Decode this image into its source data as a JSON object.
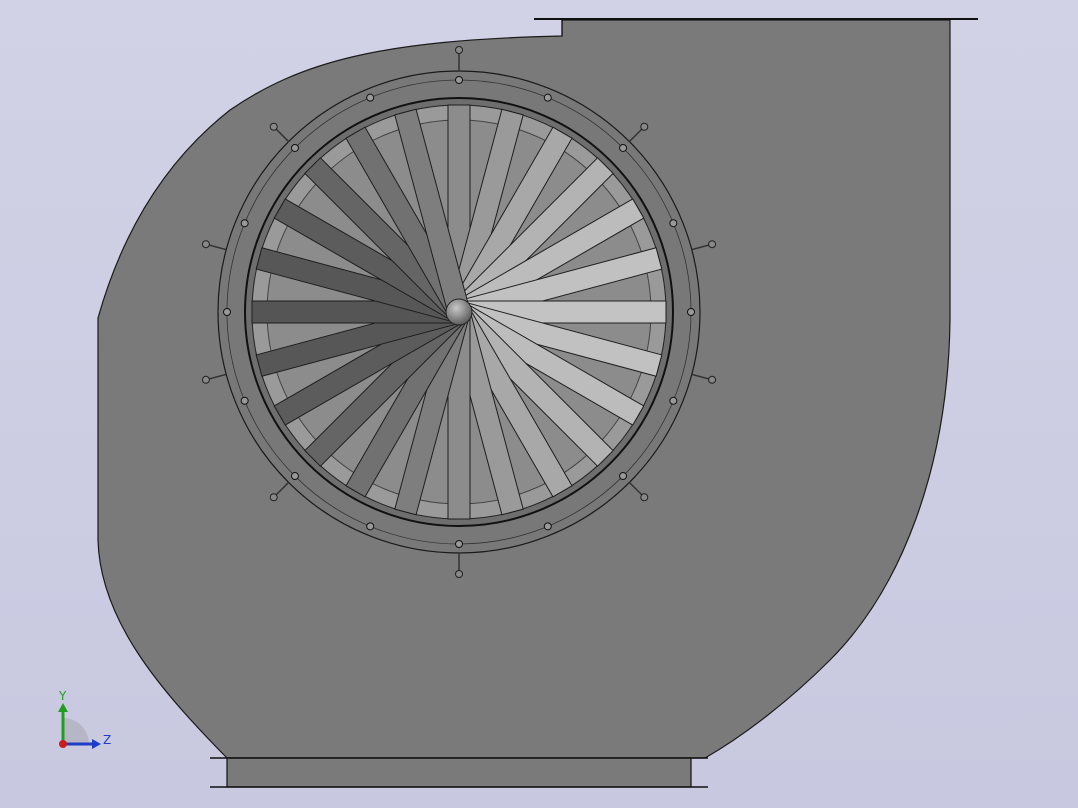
{
  "viewport": {
    "background_top": "#d2d2e6",
    "background_bottom": "#c8c8e0"
  },
  "model": {
    "housing_color": "#7a7a7a",
    "housing_edge": "#1a1a1a",
    "ring_color": "#777777",
    "impeller_back_color": "#8e8e8e",
    "blade_count": 24,
    "bolt_count": 16,
    "stud_count": 8
  },
  "triad": {
    "y_label": "Y",
    "z_label": "Z",
    "y_color": "#1ea01e",
    "z_color": "#1e3cc8",
    "x_color": "#c81e1e"
  }
}
